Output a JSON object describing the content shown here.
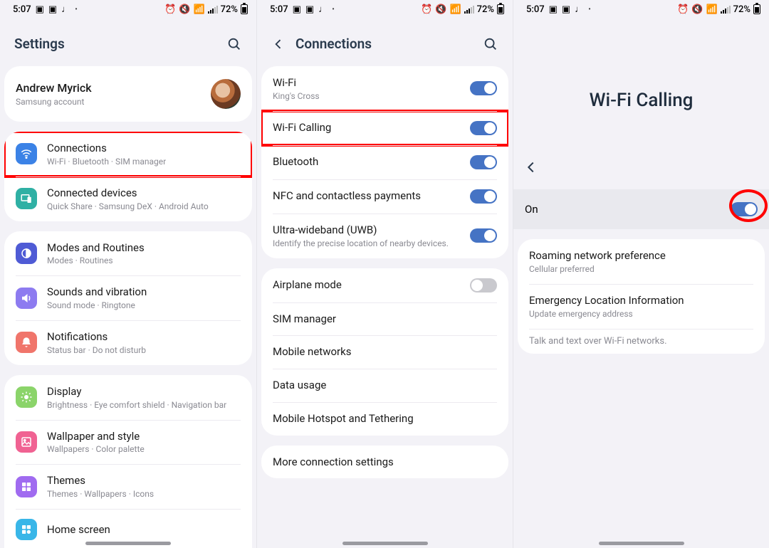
{
  "status": {
    "time": "5:07",
    "battery": "72%"
  },
  "s1": {
    "title": "Settings",
    "profile": {
      "name": "Andrew Myrick",
      "sub": "Samsung account"
    },
    "groups": [
      [
        {
          "key": "connections",
          "title": "Connections",
          "sub": "Wi-Fi  ·  Bluetooth  ·  SIM manager",
          "color": "#3b82e6",
          "hl": true
        },
        {
          "key": "connected-devices",
          "title": "Connected devices",
          "sub": "Quick Share  ·  Samsung DeX  ·  Android Auto",
          "color": "#2fb0a4"
        }
      ],
      [
        {
          "key": "modes",
          "title": "Modes and Routines",
          "sub": "Modes  ·  Routines",
          "color": "#4f5bd5"
        },
        {
          "key": "sounds",
          "title": "Sounds and vibration",
          "sub": "Sound mode  ·  Ringtone",
          "color": "#8d7bf0"
        },
        {
          "key": "notifications",
          "title": "Notifications",
          "sub": "Status bar  ·  Do not disturb",
          "color": "#f0756b"
        }
      ],
      [
        {
          "key": "display",
          "title": "Display",
          "sub": "Brightness  ·  Eye comfort shield  ·  Navigation bar",
          "color": "#8bd46a"
        },
        {
          "key": "wallpaper",
          "title": "Wallpaper and style",
          "sub": "Wallpapers  ·  Color palette",
          "color": "#f06292"
        },
        {
          "key": "themes",
          "title": "Themes",
          "sub": "Themes  ·  Wallpapers  ·  Icons",
          "color": "#a06bf0"
        },
        {
          "key": "home",
          "title": "Home screen",
          "sub": "",
          "color": "#39b6e8"
        }
      ]
    ]
  },
  "s2": {
    "title": "Connections",
    "groups": [
      [
        {
          "key": "wifi",
          "title": "Wi-Fi",
          "sub": "King's Cross",
          "toggle": true
        },
        {
          "key": "wifi-calling",
          "title": "Wi-Fi Calling",
          "toggle": true,
          "hl": true
        },
        {
          "key": "bluetooth",
          "title": "Bluetooth",
          "toggle": true
        },
        {
          "key": "nfc",
          "title": "NFC and contactless payments",
          "toggle": true
        },
        {
          "key": "uwb",
          "title": "Ultra-wideband (UWB)",
          "sub": "Identify the precise location of nearby devices.",
          "toggle": true
        }
      ],
      [
        {
          "key": "airplane",
          "title": "Airplane mode",
          "toggle": false
        },
        {
          "key": "sim",
          "title": "SIM manager"
        },
        {
          "key": "mobile",
          "title": "Mobile networks"
        },
        {
          "key": "data",
          "title": "Data usage"
        },
        {
          "key": "hotspot",
          "title": "Mobile Hotspot and Tethering"
        }
      ],
      [
        {
          "key": "more",
          "title": "More connection settings"
        }
      ]
    ]
  },
  "s3": {
    "big": "Wi-Fi Calling",
    "on": "On",
    "items": [
      {
        "key": "roaming",
        "title": "Roaming network preference",
        "sub": "Cellular preferred"
      },
      {
        "key": "emergency",
        "title": "Emergency Location Information",
        "sub": "Update emergency address"
      }
    ],
    "foot": "Talk and text over Wi-Fi networks."
  }
}
